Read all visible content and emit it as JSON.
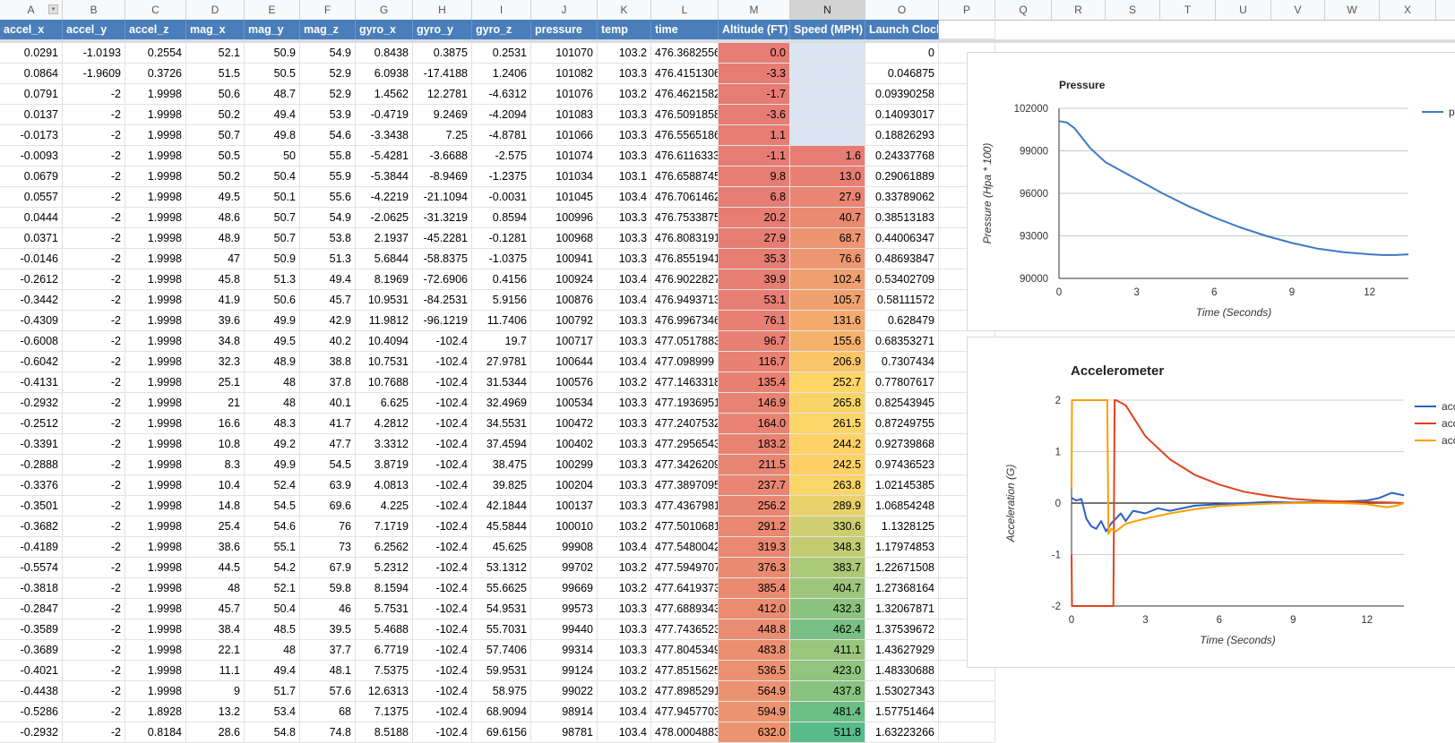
{
  "column_letters": [
    "A",
    "B",
    "C",
    "D",
    "E",
    "F",
    "G",
    "H",
    "I",
    "J",
    "K",
    "L",
    "M",
    "N",
    "O",
    "P",
    "Q",
    "R",
    "S",
    "T",
    "U",
    "V",
    "W",
    "X"
  ],
  "selected_column": "N",
  "headers": [
    "accel_x",
    "accel_y",
    "accel_z",
    "mag_x",
    "mag_y",
    "mag_z",
    "gyro_x",
    "gyro_y",
    "gyro_z",
    "pressure",
    "temp",
    "time",
    "Altitude (FT)",
    "Speed (MPH)",
    "Launch Clock"
  ],
  "rows": [
    [
      "0.0291",
      "-1.0193",
      "0.2554",
      "52.1",
      "50.9",
      "54.9",
      "0.8438",
      "0.3875",
      "0.2531",
      "101070",
      "103.2",
      "476.3682556",
      "0.0",
      "",
      "0"
    ],
    [
      "0.0864",
      "-1.9609",
      "0.3726",
      "51.5",
      "50.5",
      "52.9",
      "6.0938",
      "-17.4188",
      "1.2406",
      "101082",
      "103.3",
      "476.4151306",
      "-3.3",
      "",
      "0.046875"
    ],
    [
      "0.0791",
      "-2",
      "1.9998",
      "50.6",
      "48.7",
      "52.9",
      "1.4562",
      "12.2781",
      "-4.6312",
      "101076",
      "103.2",
      "476.4621582",
      "-1.7",
      "",
      "0.09390258"
    ],
    [
      "0.0137",
      "-2",
      "1.9998",
      "50.2",
      "49.4",
      "53.9",
      "-0.4719",
      "9.2469",
      "-4.2094",
      "101083",
      "103.3",
      "476.5091858",
      "-3.6",
      "",
      "0.14093017"
    ],
    [
      "-0.0173",
      "-2",
      "1.9998",
      "50.7",
      "49.8",
      "54.6",
      "-3.3438",
      "7.25",
      "-4.8781",
      "101066",
      "103.3",
      "476.5565186",
      "1.1",
      "",
      "0.18826293"
    ],
    [
      "-0.0093",
      "-2",
      "1.9998",
      "50.5",
      "50",
      "55.8",
      "-5.4281",
      "-3.6688",
      "-2.575",
      "101074",
      "103.3",
      "476.6116333",
      "-1.1",
      "1.6",
      "0.24337768"
    ],
    [
      "0.0679",
      "-2",
      "1.9998",
      "50.2",
      "50.4",
      "55.9",
      "-5.3844",
      "-8.9469",
      "-1.2375",
      "101034",
      "103.1",
      "476.6588745",
      "9.8",
      "13.0",
      "0.29061889"
    ],
    [
      "0.0557",
      "-2",
      "1.9998",
      "49.5",
      "50.1",
      "55.6",
      "-4.2219",
      "-21.1094",
      "-0.0031",
      "101045",
      "103.4",
      "476.7061462",
      "6.8",
      "27.9",
      "0.33789062"
    ],
    [
      "0.0444",
      "-2",
      "1.9998",
      "48.6",
      "50.7",
      "54.9",
      "-2.0625",
      "-31.3219",
      "0.8594",
      "100996",
      "103.3",
      "476.7533875",
      "20.2",
      "40.7",
      "0.38513183"
    ],
    [
      "0.0371",
      "-2",
      "1.9998",
      "48.9",
      "50.7",
      "53.8",
      "2.1937",
      "-45.2281",
      "-0.1281",
      "100968",
      "103.3",
      "476.8083191",
      "27.9",
      "68.7",
      "0.44006347"
    ],
    [
      "-0.0146",
      "-2",
      "1.9998",
      "47",
      "50.9",
      "51.3",
      "5.6844",
      "-58.8375",
      "-1.0375",
      "100941",
      "103.3",
      "476.8551941",
      "35.3",
      "76.6",
      "0.48693847"
    ],
    [
      "-0.2612",
      "-2",
      "1.9998",
      "45.8",
      "51.3",
      "49.4",
      "8.1969",
      "-72.6906",
      "0.4156",
      "100924",
      "103.4",
      "476.9022827",
      "39.9",
      "102.4",
      "0.53402709"
    ],
    [
      "-0.3442",
      "-2",
      "1.9998",
      "41.9",
      "50.6",
      "45.7",
      "10.9531",
      "-84.2531",
      "5.9156",
      "100876",
      "103.4",
      "476.9493713",
      "53.1",
      "105.7",
      "0.58111572"
    ],
    [
      "-0.4309",
      "-2",
      "1.9998",
      "39.6",
      "49.9",
      "42.9",
      "11.9812",
      "-96.1219",
      "11.7406",
      "100792",
      "103.3",
      "476.9967346",
      "76.1",
      "131.6",
      "0.628479"
    ],
    [
      "-0.6008",
      "-2",
      "1.9998",
      "34.8",
      "49.5",
      "40.2",
      "10.4094",
      "-102.4",
      "19.7",
      "100717",
      "103.3",
      "477.0517883",
      "96.7",
      "155.6",
      "0.68353271"
    ],
    [
      "-0.6042",
      "-2",
      "1.9998",
      "32.3",
      "48.9",
      "38.8",
      "10.7531",
      "-102.4",
      "27.9781",
      "100644",
      "103.4",
      "477.098999",
      "116.7",
      "206.9",
      "0.7307434"
    ],
    [
      "-0.4131",
      "-2",
      "1.9998",
      "25.1",
      "48",
      "37.8",
      "10.7688",
      "-102.4",
      "31.5344",
      "100576",
      "103.2",
      "477.1463318",
      "135.4",
      "252.7",
      "0.77807617"
    ],
    [
      "-0.2932",
      "-2",
      "1.9998",
      "21",
      "48",
      "40.1",
      "6.625",
      "-102.4",
      "32.4969",
      "100534",
      "103.3",
      "477.1936951",
      "146.9",
      "265.8",
      "0.82543945"
    ],
    [
      "-0.2512",
      "-2",
      "1.9998",
      "16.6",
      "48.3",
      "41.7",
      "4.2812",
      "-102.4",
      "34.5531",
      "100472",
      "103.3",
      "477.2407532",
      "164.0",
      "261.5",
      "0.87249755"
    ],
    [
      "-0.3391",
      "-2",
      "1.9998",
      "10.8",
      "49.2",
      "47.7",
      "3.3312",
      "-102.4",
      "37.4594",
      "100402",
      "103.3",
      "477.2956543",
      "183.2",
      "244.2",
      "0.92739868"
    ],
    [
      "-0.2888",
      "-2",
      "1.9998",
      "8.3",
      "49.9",
      "54.5",
      "3.8719",
      "-102.4",
      "38.475",
      "100299",
      "103.3",
      "477.3426209",
      "211.5",
      "242.5",
      "0.97436523"
    ],
    [
      "-0.3376",
      "-2",
      "1.9998",
      "10.4",
      "52.4",
      "63.9",
      "4.0813",
      "-102.4",
      "39.825",
      "100204",
      "103.3",
      "477.3897095",
      "237.7",
      "263.8",
      "1.02145385"
    ],
    [
      "-0.3501",
      "-2",
      "1.9998",
      "14.8",
      "54.5",
      "69.6",
      "4.225",
      "-102.4",
      "42.1844",
      "100137",
      "103.3",
      "477.4367981",
      "256.2",
      "289.9",
      "1.06854248"
    ],
    [
      "-0.3682",
      "-2",
      "1.9998",
      "25.4",
      "54.6",
      "76",
      "7.1719",
      "-102.4",
      "45.5844",
      "100010",
      "103.2",
      "477.5010681",
      "291.2",
      "330.6",
      "1.1328125"
    ],
    [
      "-0.4189",
      "-2",
      "1.9998",
      "38.6",
      "55.1",
      "73",
      "6.2562",
      "-102.4",
      "45.625",
      "99908",
      "103.4",
      "477.5480042",
      "319.3",
      "348.3",
      "1.17974853"
    ],
    [
      "-0.5574",
      "-2",
      "1.9998",
      "44.5",
      "54.2",
      "67.9",
      "5.2312",
      "-102.4",
      "53.1312",
      "99702",
      "103.2",
      "477.5949707",
      "376.3",
      "383.7",
      "1.22671508"
    ],
    [
      "-0.3818",
      "-2",
      "1.9998",
      "48",
      "52.1",
      "59.8",
      "8.1594",
      "-102.4",
      "55.6625",
      "99669",
      "103.2",
      "477.6419373",
      "385.4",
      "404.7",
      "1.27368164"
    ],
    [
      "-0.2847",
      "-2",
      "1.9998",
      "45.7",
      "50.4",
      "46",
      "5.7531",
      "-102.4",
      "54.9531",
      "99573",
      "103.3",
      "477.6889343",
      "412.0",
      "432.3",
      "1.32067871"
    ],
    [
      "-0.3589",
      "-2",
      "1.9998",
      "38.4",
      "48.5",
      "39.5",
      "5.4688",
      "-102.4",
      "55.7031",
      "99440",
      "103.3",
      "477.7436523",
      "448.8",
      "462.4",
      "1.37539672"
    ],
    [
      "-0.3689",
      "-2",
      "1.9998",
      "22.1",
      "48",
      "37.7",
      "6.7719",
      "-102.4",
      "57.7406",
      "99314",
      "103.3",
      "477.8045349",
      "483.8",
      "411.1",
      "1.43627929"
    ],
    [
      "-0.4021",
      "-2",
      "1.9998",
      "11.1",
      "49.4",
      "48.1",
      "7.5375",
      "-102.4",
      "59.9531",
      "99124",
      "103.2",
      "477.8515625",
      "536.5",
      "423.0",
      "1.48330688"
    ],
    [
      "-0.4438",
      "-2",
      "1.9998",
      "9",
      "51.7",
      "57.6",
      "12.6313",
      "-102.4",
      "58.975",
      "99022",
      "103.2",
      "477.8985291",
      "564.9",
      "437.8",
      "1.53027343"
    ],
    [
      "-0.5286",
      "-2",
      "1.8928",
      "13.2",
      "53.4",
      "68",
      "7.1375",
      "-102.4",
      "68.9094",
      "98914",
      "103.4",
      "477.9457703",
      "594.9",
      "481.4",
      "1.57751464"
    ],
    [
      "-0.2932",
      "-2",
      "0.8184",
      "28.6",
      "54.8",
      "74.8",
      "8.5188",
      "-102.4",
      "69.6156",
      "98781",
      "103.4",
      "478.0004883",
      "632.0",
      "511.8",
      "1.63223266"
    ]
  ],
  "colors": {
    "header_bg": "#4a7ebb",
    "altitude_scale": [
      "#e67c73",
      "#f6b26b"
    ],
    "speed_scale": [
      "#e67c73",
      "#ffd666",
      "#57bb8a"
    ],
    "speed_blank_bg": "#dbe5f1",
    "pressure_line": "#3f78c8",
    "accel_x": "#2a62c9",
    "accel_y": "#e0431f",
    "accel_z": "#ff9f00"
  },
  "chart_data": [
    {
      "type": "line",
      "title": "Pressure",
      "xlabel": "Time (Seconds)",
      "ylabel": "Pressure (Hpa * 100)",
      "xlim": [
        0,
        13.5
      ],
      "ylim": [
        90000,
        102000
      ],
      "x_ticks": [
        "0",
        "3",
        "6",
        "9",
        "12"
      ],
      "y_ticks": [
        "90000",
        "93000",
        "96000",
        "99000",
        "102000"
      ],
      "legend_position": "right",
      "series": [
        {
          "name": "pr",
          "color": "#3f78c8",
          "x": [
            0,
            0.3,
            0.6,
            0.9,
            1.2,
            1.5,
            1.8,
            2.4,
            3,
            4,
            5,
            6,
            7,
            8,
            9,
            10,
            11,
            12,
            12.5,
            13,
            13.5
          ],
          "y": [
            101100,
            101000,
            100600,
            99900,
            99200,
            98700,
            98200,
            97600,
            97000,
            96000,
            95100,
            94300,
            93600,
            93000,
            92500,
            92100,
            91850,
            91700,
            91650,
            91650,
            91700
          ]
        }
      ]
    },
    {
      "type": "line",
      "title": "Accelerometer",
      "xlabel": "Time (Seconds)",
      "ylabel": "Acceleration (G)",
      "xlim": [
        0,
        13.5
      ],
      "ylim": [
        -2,
        2
      ],
      "x_ticks": [
        "0",
        "3",
        "6",
        "9",
        "12"
      ],
      "y_ticks": [
        "-2",
        "-1",
        "0",
        "1",
        "2"
      ],
      "legend_position": "right",
      "legend_labels": [
        "acc",
        "acc",
        "acc"
      ],
      "series": [
        {
          "name": "acc",
          "color": "#2a62c9",
          "x": [
            0,
            0.2,
            0.4,
            0.6,
            0.8,
            1.0,
            1.2,
            1.4,
            1.6,
            1.8,
            2.0,
            2.2,
            2.5,
            3,
            3.5,
            4,
            5,
            6,
            7,
            8,
            9,
            10,
            11,
            12,
            12.5,
            13,
            13.5
          ],
          "y": [
            0.1,
            0.05,
            0.08,
            -0.3,
            -0.45,
            -0.5,
            -0.35,
            -0.55,
            -0.4,
            -0.3,
            -0.2,
            -0.35,
            -0.15,
            -0.2,
            -0.1,
            -0.15,
            -0.05,
            -0.02,
            0.0,
            0.02,
            0.01,
            0.02,
            0.03,
            0.05,
            0.1,
            0.2,
            0.15
          ]
        },
        {
          "name": "acc",
          "color": "#e0431f",
          "x": [
            0,
            0.02,
            0.05,
            1.7,
            1.75,
            1.8,
            2.2,
            3,
            4,
            5,
            6,
            7,
            8,
            9,
            10,
            11,
            12,
            13,
            13.5
          ],
          "y": [
            -1.0,
            -2.0,
            -2.0,
            -2.0,
            2.0,
            2.0,
            1.9,
            1.3,
            0.85,
            0.55,
            0.36,
            0.22,
            0.14,
            0.08,
            0.05,
            0.03,
            0.02,
            0.01,
            0.0
          ]
        },
        {
          "name": "acc",
          "color": "#ff9f00",
          "x": [
            0,
            0.02,
            0.05,
            1.4,
            1.45,
            1.5,
            1.6,
            1.8,
            2.2,
            3,
            4,
            5,
            6,
            7,
            8,
            9,
            10,
            11,
            12,
            12.8,
            13.2,
            13.5
          ],
          "y": [
            0.3,
            2.0,
            2.0,
            2.0,
            2.0,
            -0.6,
            -0.5,
            -0.55,
            -0.4,
            -0.3,
            -0.2,
            -0.12,
            -0.06,
            -0.03,
            -0.01,
            0.0,
            0.01,
            0.0,
            -0.02,
            -0.08,
            -0.05,
            0.0
          ]
        }
      ]
    }
  ]
}
